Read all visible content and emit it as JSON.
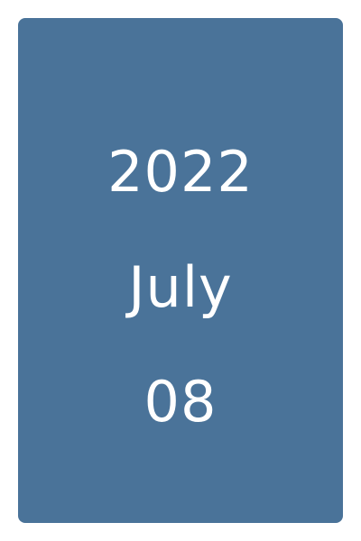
{
  "date_card": {
    "year": "2022",
    "month": "July",
    "day": "08",
    "background_color": "#4A7399",
    "text_color": "#FFFFFF"
  }
}
